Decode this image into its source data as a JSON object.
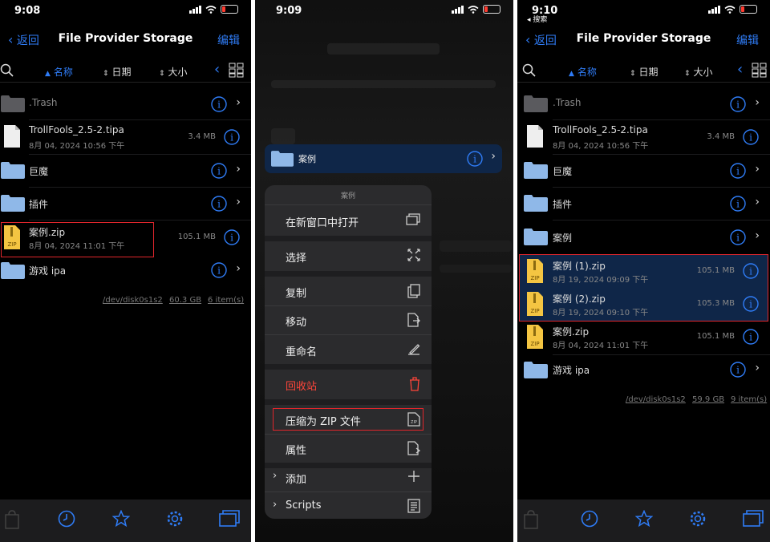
{
  "colors": {
    "accent": "#2f7cf6",
    "destructive": "#ff453a",
    "highlight_box": "#e0262c",
    "selection": "#0f2648"
  },
  "panel1": {
    "time": "9:08",
    "back": "返回",
    "title": "File Provider Storage",
    "edit": "编辑",
    "sort": {
      "name": "名称",
      "date": "日期",
      "size": "大小"
    },
    "rows": [
      {
        "name": ".Trash",
        "type": "folder"
      },
      {
        "name": "TrollFools_2.5-2.tipa",
        "date": "8月 04, 2024 10:56 下午",
        "size": "3.4 MB",
        "type": "file"
      },
      {
        "name": "巨魔",
        "type": "folder"
      },
      {
        "name": "插件",
        "type": "folder"
      },
      {
        "name": "案例.zip",
        "date": "8月 04, 2024 11:01 下午",
        "size": "105.1 MB",
        "type": "zip"
      },
      {
        "name": "游戏 ipa",
        "type": "folder"
      }
    ],
    "footer": {
      "disk": "/dev/disk0s1s2",
      "free": "60.3 GB",
      "items": "6 item(s)"
    }
  },
  "panel2": {
    "time": "9:09",
    "selected": "案例",
    "menu_title": "案例",
    "menu": [
      {
        "label": "在新窗口中打开",
        "icon": "window-icon"
      },
      {
        "label": "选择",
        "icon": "select-icon"
      },
      {
        "label": "复制",
        "icon": "copy-icon"
      },
      {
        "label": "移动",
        "icon": "move-icon"
      },
      {
        "label": "重命名",
        "icon": "rename-icon"
      },
      {
        "label": "回收站",
        "icon": "trash-icon"
      },
      {
        "label": "压缩为 ZIP 文件",
        "icon": "zip-icon"
      },
      {
        "label": "属性",
        "icon": "properties-icon"
      },
      {
        "label": "添加",
        "icon": "plus-icon"
      },
      {
        "label": "Scripts",
        "icon": "script-icon"
      }
    ]
  },
  "panel3": {
    "time": "9:10",
    "back_sub": "◂ 搜索",
    "back": "返回",
    "title": "File Provider Storage",
    "edit": "编辑",
    "sort": {
      "name": "名称",
      "date": "日期",
      "size": "大小"
    },
    "rows": [
      {
        "name": ".Trash",
        "type": "folder"
      },
      {
        "name": "TrollFools_2.5-2.tipa",
        "date": "8月 04, 2024 10:56 下午",
        "size": "3.4 MB",
        "type": "file"
      },
      {
        "name": "巨魔",
        "type": "folder"
      },
      {
        "name": "插件",
        "type": "folder"
      },
      {
        "name": "案例",
        "type": "folder"
      },
      {
        "name": "案例 (1).zip",
        "date": "8月 19, 2024 09:09 下午",
        "size": "105.1 MB",
        "type": "zip"
      },
      {
        "name": "案例 (2).zip",
        "date": "8月 19, 2024 09:10 下午",
        "size": "105.3 MB",
        "type": "zip"
      },
      {
        "name": "案例.zip",
        "date": "8月 04, 2024 11:01 下午",
        "size": "105.1 MB",
        "type": "zip"
      },
      {
        "name": "游戏 ipa",
        "type": "folder"
      }
    ],
    "footer": {
      "disk": "/dev/disk0s1s2",
      "free": "59.9 GB",
      "items": "9 item(s)"
    }
  }
}
